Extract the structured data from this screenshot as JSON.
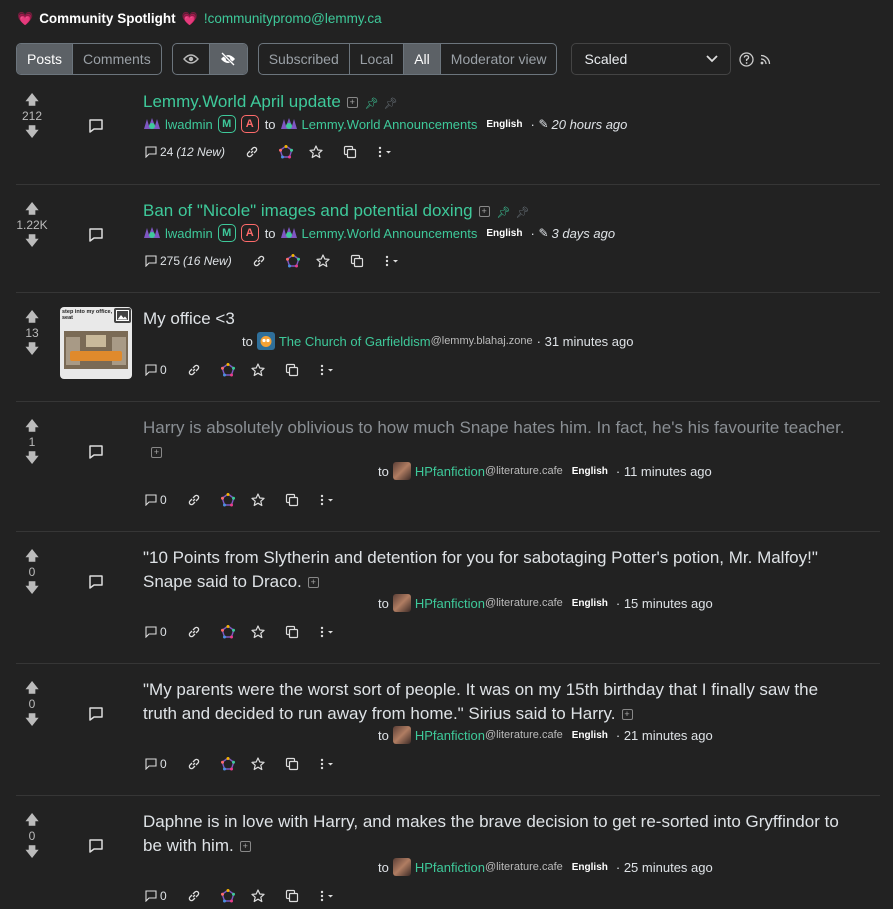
{
  "spotlight": {
    "title": "Community Spotlight",
    "link": "!communitypromo@lemmy.ca"
  },
  "toolbar": {
    "type_tabs": [
      "Posts",
      "Comments"
    ],
    "listing_tabs": [
      "Subscribed",
      "Local",
      "All",
      "Moderator view"
    ],
    "sort_select": "Scaled"
  },
  "posts": [
    {
      "score": "212",
      "title": "Lemmy.World April update",
      "user": "lwadmin",
      "badge_m": "M",
      "badge_a": "A",
      "to": "to",
      "community": "Lemmy.World Announcements",
      "language": "English",
      "time": "20 hours ago",
      "comments": "24",
      "new_comments": "(12 New)"
    },
    {
      "score": "1.22K",
      "title": "Ban of \"Nicole\" images and potential doxing",
      "user": "lwadmin",
      "badge_m": "M",
      "badge_a": "A",
      "to": "to",
      "community": "Lemmy.World Announcements",
      "language": "English",
      "time": "3 days ago",
      "comments": "275",
      "new_comments": "(16 New)"
    },
    {
      "score": "13",
      "title": "My office <3",
      "to": "to",
      "community": "The Church of Garfieldism",
      "instance": "@lemmy.blahaj.zone",
      "time": "31 minutes ago",
      "comments": "0",
      "thumb_text": "step into my office, seat"
    },
    {
      "score": "1",
      "title": "Harry is absolutely oblivious to how much Snape hates him. In fact, he's his favourite teacher.",
      "to": "to",
      "community": "HPfanfiction",
      "instance": "@literature.cafe",
      "language": "English",
      "time": "11 minutes ago",
      "comments": "0"
    },
    {
      "score": "0",
      "title_line1": "\"10 Points from Slytherin and detention for you for sabotaging Potter's potion, Mr. Malfoy!\"",
      "title_line2": "Snape said to Draco.",
      "to": "to",
      "community": "HPfanfiction",
      "instance": "@literature.cafe",
      "language": "English",
      "time": "15 minutes ago",
      "comments": "0"
    },
    {
      "score": "0",
      "title_line1": "\"My parents were the worst sort of people. It was on my 15th birthday that I finally saw the",
      "title_line2": "truth and decided to run away from home.\" Sirius said to Harry.",
      "to": "to",
      "community": "HPfanfiction",
      "instance": "@literature.cafe",
      "language": "English",
      "time": "21 minutes ago",
      "comments": "0"
    },
    {
      "score": "0",
      "title_line1": "Daphne is in love with Harry, and makes the brave decision to get re-sorted into Gryffindor to",
      "title_line2": "be with him.",
      "to": "to",
      "community": "HPfanfiction",
      "instance": "@literature.cafe",
      "language": "English",
      "time": "25 minutes ago",
      "comments": "0"
    }
  ]
}
